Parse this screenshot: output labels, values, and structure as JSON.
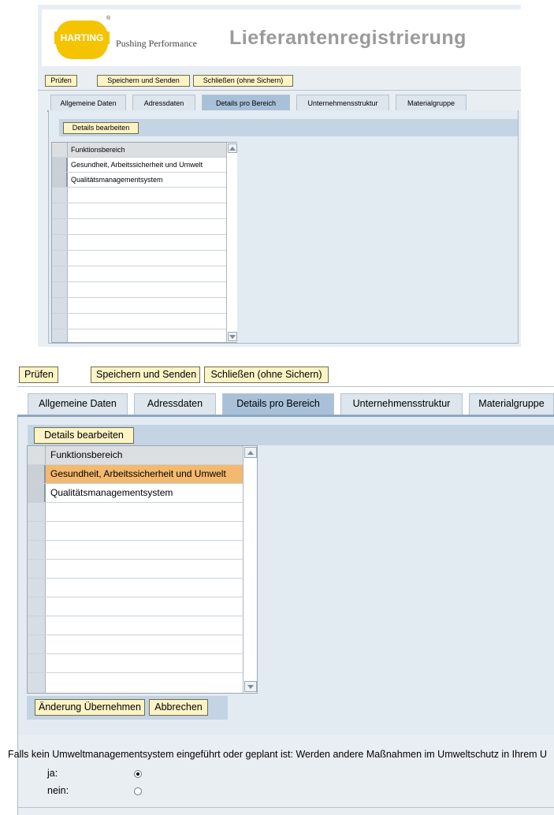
{
  "brand": {
    "logo_text": "HARTING",
    "logo_mark": "®",
    "tagline": "Pushing Performance",
    "page_title": "Lieferantenregistrierung"
  },
  "toolbar": {
    "check": "Prüfen",
    "save_send": "Speichern und Senden",
    "close_nosave": "Schließen (ohne Sichern)"
  },
  "tabs": [
    {
      "label": "Allgemeine Daten",
      "active": false
    },
    {
      "label": "Adressdaten",
      "active": false
    },
    {
      "label": "Details pro Bereich",
      "active": true
    },
    {
      "label": "Unternehmensstruktur",
      "active": false
    },
    {
      "label": "Materialgruppe",
      "active": false
    }
  ],
  "section": {
    "edit_button": "Details bearbeiten"
  },
  "table": {
    "header": "Funktionsbereich",
    "rows": [
      "Gesundheit, Arbeitssicherheit und Umwelt",
      "Qualitätsmanagementsystem"
    ]
  },
  "edit_actions": {
    "apply": "Änderung Übernehmen",
    "cancel": "Abbrechen"
  },
  "question": {
    "text": "Falls kein Umweltmanagementsystem eingeführt oder geplant ist: Werden andere Maßnahmen im Umweltschutz in Ihrem U",
    "options": [
      {
        "label": "ja:",
        "selected": true
      },
      {
        "label": "nein:",
        "selected": false
      }
    ]
  },
  "colors": {
    "button_bg": "#fdf4c6",
    "active_tab": "#a9c1d8",
    "highlight_row": "#f3b96e",
    "logo_yellow": "#f4c400"
  }
}
